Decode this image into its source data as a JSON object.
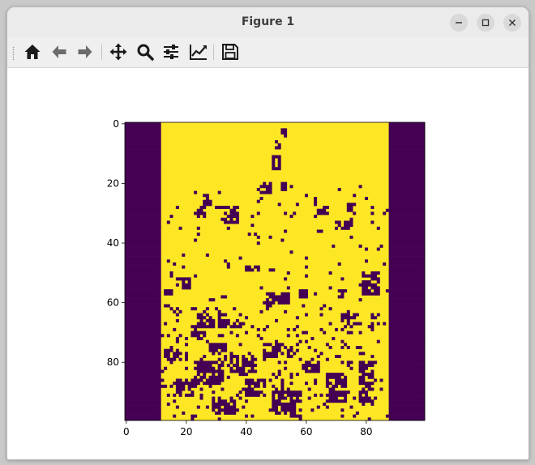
{
  "window": {
    "title": "Figure 1"
  },
  "titlebar_buttons": [
    {
      "name": "minimize-button",
      "icon": "minimize-icon"
    },
    {
      "name": "maximize-button",
      "icon": "maximize-icon"
    },
    {
      "name": "close-button",
      "icon": "close-icon"
    }
  ],
  "toolbar": {
    "buttons": [
      {
        "name": "home-button",
        "icon": "home-icon",
        "tooltip": "Reset original view"
      },
      {
        "name": "back-button",
        "icon": "arrow-left-icon",
        "tooltip": "Back to previous view"
      },
      {
        "name": "forward-button",
        "icon": "arrow-right-icon",
        "tooltip": "Forward to next view"
      },
      {
        "name": "pan-button",
        "icon": "move-icon",
        "tooltip": "Pan axes"
      },
      {
        "name": "zoom-button",
        "icon": "magnifier-icon",
        "tooltip": "Zoom to rectangle"
      },
      {
        "name": "configure-subplots-button",
        "icon": "sliders-icon",
        "tooltip": "Configure subplots"
      },
      {
        "name": "edit-axis-button",
        "icon": "line-chart-icon",
        "tooltip": "Edit axis"
      },
      {
        "name": "save-button",
        "icon": "floppy-disk-icon",
        "tooltip": "Save the figure"
      }
    ]
  },
  "chart_data": {
    "type": "heatmap",
    "title": "",
    "xlabel": "",
    "ylabel": "",
    "xlim": [
      -0.5,
      99.5
    ],
    "ylim": [
      99.5,
      -0.5
    ],
    "x_ticks": [
      "0",
      "20",
      "40",
      "60",
      "80"
    ],
    "y_ticks": [
      "0",
      "20",
      "40",
      "60",
      "80"
    ],
    "colormap": "viridis",
    "colors": {
      "low": "#440154",
      "high": "#fde725"
    },
    "grid": false,
    "shape": [
      100,
      100
    ],
    "columns_low": [
      [
        0,
        11
      ],
      [
        88,
        99
      ]
    ],
    "description_values": "binary image: 0 (dark) and 1 (yellow)"
  }
}
